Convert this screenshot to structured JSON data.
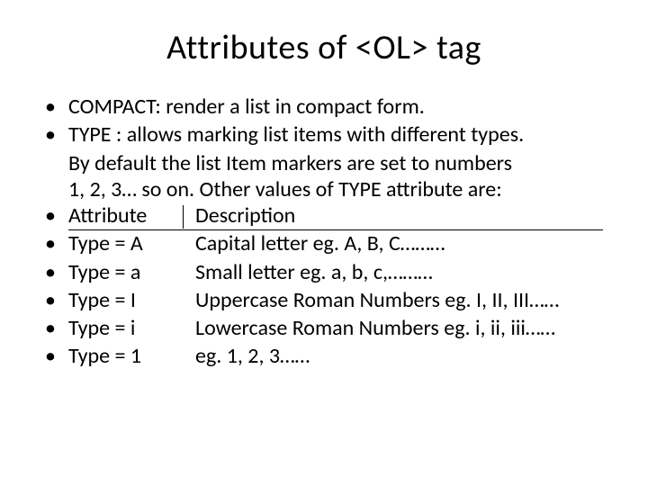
{
  "title": "Attributes of <OL> tag",
  "bullets": {
    "b0": "COMPACT: render a list in compact form.",
    "b1_l1": "TYPE  : allows marking list items with different types.",
    "b1_l2": "By default the list Item markers are set to numbers",
    "b1_l3": "1, 2, 3… so on. Other values of TYPE attribute are:"
  },
  "table": {
    "header_attr": "Attribute",
    "header_desc": "Description",
    "rows": [
      {
        "attr": "Type = A",
        "desc": "Capital letter eg. A, B, C………"
      },
      {
        "attr": "Type = a",
        "desc": "Small letter eg. a, b, c,………"
      },
      {
        "attr": "Type = I",
        "desc": "Uppercase Roman Numbers eg. I, II, III……"
      },
      {
        "attr": "Type = i",
        "desc": "Lowercase Roman Numbers eg. i, ii, iii……"
      },
      {
        "attr": "Type = 1",
        "desc": "eg.   1, 2, 3……"
      }
    ]
  }
}
